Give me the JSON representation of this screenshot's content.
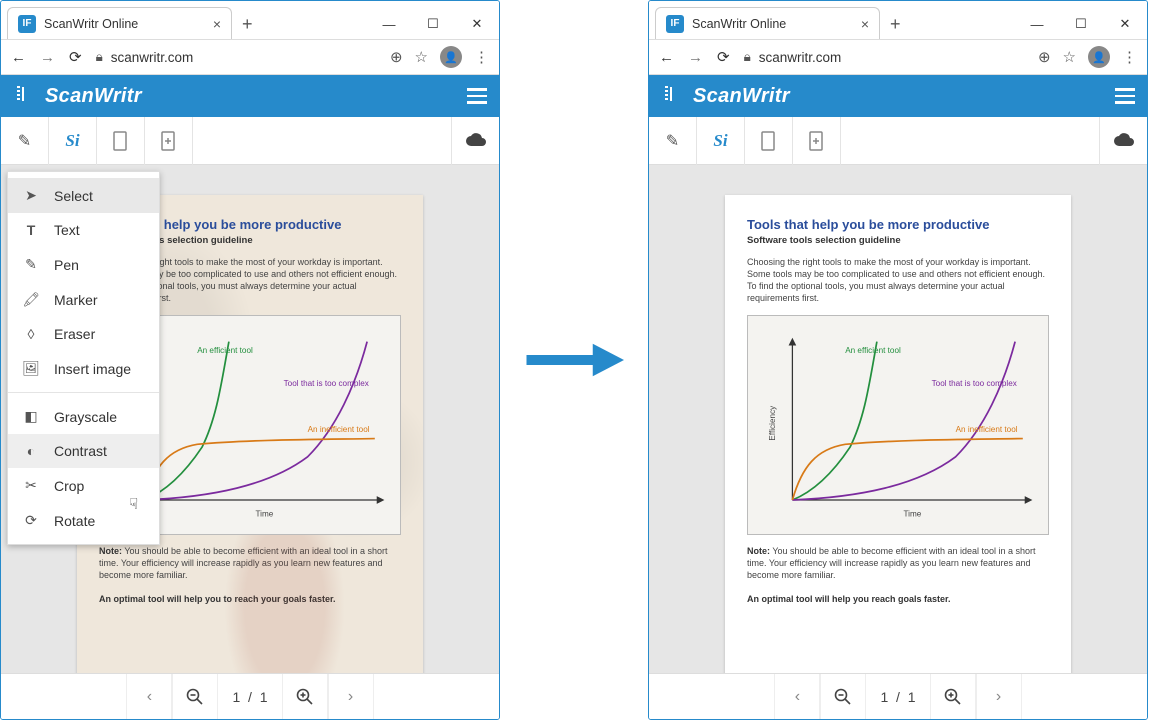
{
  "browser": {
    "tab_title": "ScanWritr Online",
    "favicon_badge": "IF",
    "url_display": "scanwritr.com"
  },
  "app": {
    "name": "ScanWritr",
    "signature_tool_label": "Si"
  },
  "menu": {
    "select": "Select",
    "text": "Text",
    "pen": "Pen",
    "marker": "Marker",
    "eraser": "Eraser",
    "insert_image": "Insert image",
    "grayscale": "Grayscale",
    "contrast": "Contrast",
    "crop": "Crop",
    "rotate": "Rotate"
  },
  "document": {
    "title": "Tools that help you be more productive",
    "subtitle": "Software tools selection guideline",
    "intro": "Choosing the right tools to make the most of your workday is important. Some tools may be too complicated to use and others not efficient enough. To find the optional tools, you must always determine your actual requirements first.",
    "note_label": "Note:",
    "note_body": "You should be able to become efficient with an ideal tool in a short time. Your efficiency will increase rapidly as you learn new features and become more familiar.",
    "optimal": "An optimal tool will help you to reach your goals faster.",
    "optimal_clean": "An optimal tool will help you reach goals faster."
  },
  "chart_data": {
    "type": "line",
    "title": "",
    "xlabel": "Time",
    "ylabel": "Efficiency",
    "xlim": [
      0,
      10
    ],
    "ylim": [
      0,
      10
    ],
    "series": [
      {
        "name": "An efficient tool",
        "color": "#238f3e",
        "x": [
          0,
          1,
          2,
          3,
          4,
          4.5
        ],
        "y": [
          0,
          0.6,
          1.6,
          3.2,
          6.5,
          10
        ]
      },
      {
        "name": "Tool that is too complex",
        "color": "#7b2a9e",
        "x": [
          0,
          2,
          4,
          6,
          8,
          9,
          9.8
        ],
        "y": [
          0,
          0.2,
          0.5,
          1.4,
          4.0,
          6.5,
          10
        ]
      },
      {
        "name": "An inefficient tool",
        "color": "#d87a17",
        "x": [
          0,
          0.6,
          1.5,
          3,
          6,
          10
        ],
        "y": [
          0,
          2.4,
          3.2,
          3.5,
          3.6,
          3.7
        ]
      }
    ],
    "annotations": [
      {
        "series": 0,
        "text": "An efficient tool",
        "x": 4.8,
        "y": 9.0
      },
      {
        "series": 1,
        "text": "Tool that is too complex",
        "x": 7.0,
        "y": 3.5
      },
      {
        "series": 2,
        "text": "An inefficient tool",
        "x": 8.0,
        "y": 4.2
      }
    ]
  },
  "pager": {
    "current": "1",
    "sep": "/",
    "total": "1"
  }
}
